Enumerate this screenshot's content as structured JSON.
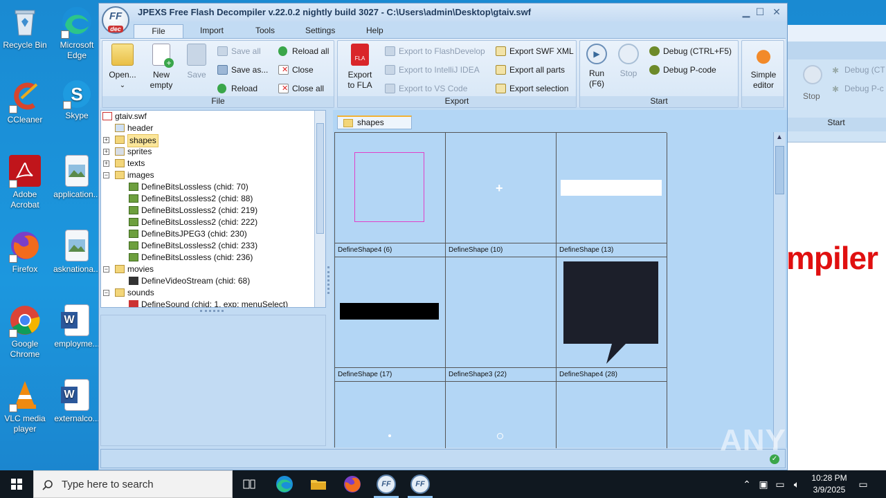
{
  "desktop": {
    "icons": [
      {
        "label": "Recycle Bin",
        "color": "#5aa0d8"
      },
      {
        "label": "Microsoft Edge",
        "color": "#1aa37a"
      },
      {
        "label": "CCleaner",
        "color": "#d8452c"
      },
      {
        "label": "Skype",
        "color": "#1e9be0"
      },
      {
        "label": "Adobe Acrobat",
        "color": "#c0151b"
      },
      {
        "label": "application...",
        "color": "#e8eef4"
      },
      {
        "label": "Firefox",
        "color": "#f26b1d"
      },
      {
        "label": "asknationa...",
        "color": "#e8eef4"
      },
      {
        "label": "Google Chrome",
        "color": "#2f8f3f"
      },
      {
        "label": "employme...",
        "color": "#2b579a"
      },
      {
        "label": "VLC media player",
        "color": "#f08a10"
      },
      {
        "label": "externalco...",
        "color": "#2b579a"
      }
    ]
  },
  "window": {
    "title": "JPEXS Free Flash Decompiler v.22.0.2 nightly build 3027 - C:\\Users\\admin\\Desktop\\gtaiv.swf",
    "logo_text": "FF",
    "logo_sub": "dec",
    "tabs": [
      "File",
      "Import",
      "Tools",
      "Settings",
      "Help"
    ],
    "active_tab": "File"
  },
  "ribbon": {
    "file_group": {
      "label": "File",
      "open": "Open...",
      "new_empty_1": "New",
      "new_empty_2": "empty",
      "save": "Save",
      "save_all": "Save all",
      "save_as": "Save as...",
      "reload": "Reload",
      "reload_all": "Reload all",
      "close": "Close",
      "close_all": "Close all"
    },
    "export_group": {
      "label": "Export",
      "export_fla_1": "Export",
      "export_fla_2": "to FLA",
      "export_flashdevelop": "Export to FlashDevelop",
      "export_intellij": "Export to IntelliJ IDEA",
      "export_vscode": "Export to VS Code",
      "export_swf_xml": "Export SWF XML",
      "export_all_parts": "Export all parts",
      "export_selection": "Export selection"
    },
    "start_group": {
      "label": "Start",
      "run_1": "Run",
      "run_2": "(F6)",
      "stop": "Stop",
      "debug": "Debug (CTRL+F5)",
      "debug_pcode": "Debug P-code"
    },
    "simple_editor_1": "Simple",
    "simple_editor_2": "editor"
  },
  "tree": {
    "root": "gtaiv.swf",
    "items": [
      {
        "label": "header",
        "level": 1
      },
      {
        "label": "shapes",
        "level": 1
      },
      {
        "label": "sprites",
        "level": 1
      },
      {
        "label": "texts",
        "level": 1
      },
      {
        "label": "images",
        "level": 1
      },
      {
        "label": "DefineBitsLossless (chid: 70)",
        "level": 2
      },
      {
        "label": "DefineBitsLossless2 (chid: 88)",
        "level": 2
      },
      {
        "label": "DefineBitsLossless2 (chid: 219)",
        "level": 2
      },
      {
        "label": "DefineBitsLossless2 (chid: 222)",
        "level": 2
      },
      {
        "label": "DefineBitsJPEG3 (chid: 230)",
        "level": 2
      },
      {
        "label": "DefineBitsLossless2 (chid: 233)",
        "level": 2
      },
      {
        "label": "DefineBitsLossless (chid: 236)",
        "level": 2
      },
      {
        "label": "movies",
        "level": 1
      },
      {
        "label": "DefineVideoStream (chid: 68)",
        "level": 2
      },
      {
        "label": "sounds",
        "level": 1
      },
      {
        "label": "DefineSound (chid: 1, exp: menuSelect)",
        "level": 2
      }
    ]
  },
  "shapes_panel": {
    "tab_label": "shapes",
    "cells": [
      "DefineShape4 (6)",
      "DefineShape (10)",
      "DefineShape (13)",
      "DefineShape (17)",
      "DefineShape3 (22)",
      "DefineShape4 (28)",
      "",
      "",
      ""
    ]
  },
  "background_window": {
    "stop": "Stop",
    "debug": "Debug (CT",
    "debug_pcode": "Debug P-c",
    "start": "Start",
    "big_text": "mpiler"
  },
  "watermark": "ANY RUN",
  "taskbar": {
    "search_placeholder": "Type here to search",
    "time": "10:28 PM",
    "date": "3/9/2025"
  }
}
